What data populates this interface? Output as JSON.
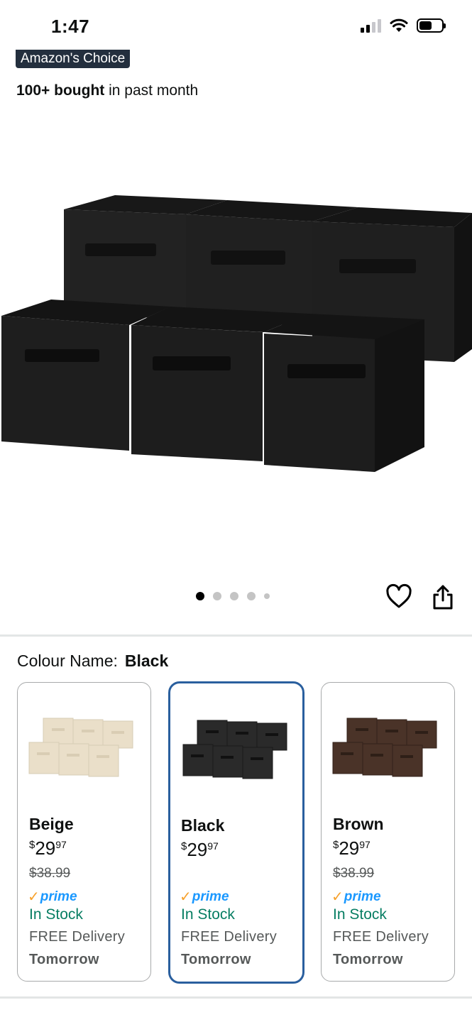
{
  "status_bar": {
    "time": "1:47"
  },
  "badge": {
    "label": "Amazon's Choice"
  },
  "bought": {
    "bold": "100+ bought",
    "rest": " in past month"
  },
  "gallery": {
    "image_count": 5,
    "active_index": 0
  },
  "colour": {
    "label": "Colour Name:",
    "selected": "Black"
  },
  "swatches": [
    {
      "name": "Beige",
      "currency": "$",
      "price_whole": "29",
      "price_fraction": "97",
      "list_price": "$38.99",
      "prime": "prime",
      "stock": "In Stock",
      "delivery": "FREE Delivery",
      "delivery_day": "Tomorrow",
      "color": "#eadfc9"
    },
    {
      "name": "Black",
      "currency": "$",
      "price_whole": "29",
      "price_fraction": "97",
      "prime": "prime",
      "stock": "In Stock",
      "delivery": "FREE Delivery",
      "delivery_day": "Tomorrow",
      "color": "#2a2a2a"
    },
    {
      "name": "Brown",
      "currency": "$",
      "price_whole": "29",
      "price_fraction": "97",
      "list_price": "$38.99",
      "prime": "prime",
      "stock": "In Stock",
      "delivery": "FREE Delivery",
      "delivery_day": "Tomorrow",
      "color": "#4a3328"
    }
  ],
  "colors": {
    "prime_blue": "#1a98ff",
    "prime_check": "#f7a12c",
    "in_stock": "#067d62",
    "selected_border": "#2a5f9e",
    "badge_bg": "#232f3e"
  }
}
